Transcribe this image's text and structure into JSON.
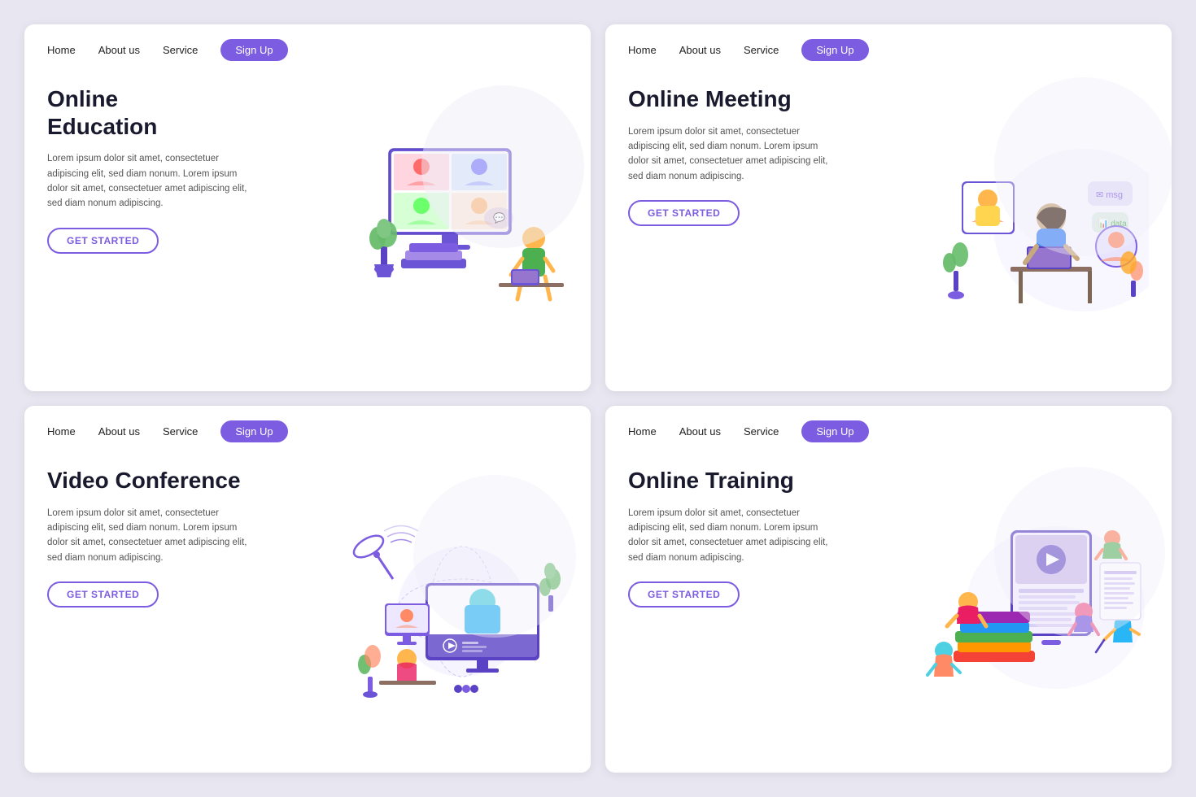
{
  "cards": [
    {
      "id": "online-education",
      "title": "Online\nEducation",
      "description": "Lorem ipsum dolor sit amet, consectetuer adipiscing elit, sed diam nonum. Lorem ipsum dolor sit amet, consectetuer amet adipiscing elit, sed diam nonum adipiscing.",
      "btn_label": "GET STARTED",
      "nav": {
        "home": "Home",
        "about": "About us",
        "service": "Service",
        "signup": "Sign Up"
      }
    },
    {
      "id": "online-meeting",
      "title": "Online Meeting",
      "description": "Lorem ipsum dolor sit amet, consectetuer adipiscing elit, sed diam nonum. Lorem ipsum dolor sit amet, consectetuer amet adipiscing elit, sed diam nonum adipiscing.",
      "btn_label": "GET STARTED",
      "nav": {
        "home": "Home",
        "about": "About us",
        "service": "Service",
        "signup": "Sign Up"
      }
    },
    {
      "id": "video-conference",
      "title": "Video Conference",
      "description": "Lorem ipsum dolor sit amet, consectetuer adipiscing elit, sed diam nonum. Lorem ipsum dolor sit amet, consectetuer amet adipiscing elit, sed diam nonum adipiscing.",
      "btn_label": "GET STARTED",
      "nav": {
        "home": "Home",
        "about": "About us",
        "service": "Service",
        "signup": "Sign Up"
      }
    },
    {
      "id": "online-training",
      "title": "Online Training",
      "description": "Lorem ipsum dolor sit amet, consectetuer adipiscing elit, sed diam nonum. Lorem ipsum dolor sit amet, consectetuer amet adipiscing elit, sed diam nonum adipiscing.",
      "btn_label": "GET STARTED",
      "nav": {
        "home": "Home",
        "about": "About us",
        "service": "Service",
        "signup": "Sign Up"
      }
    }
  ]
}
